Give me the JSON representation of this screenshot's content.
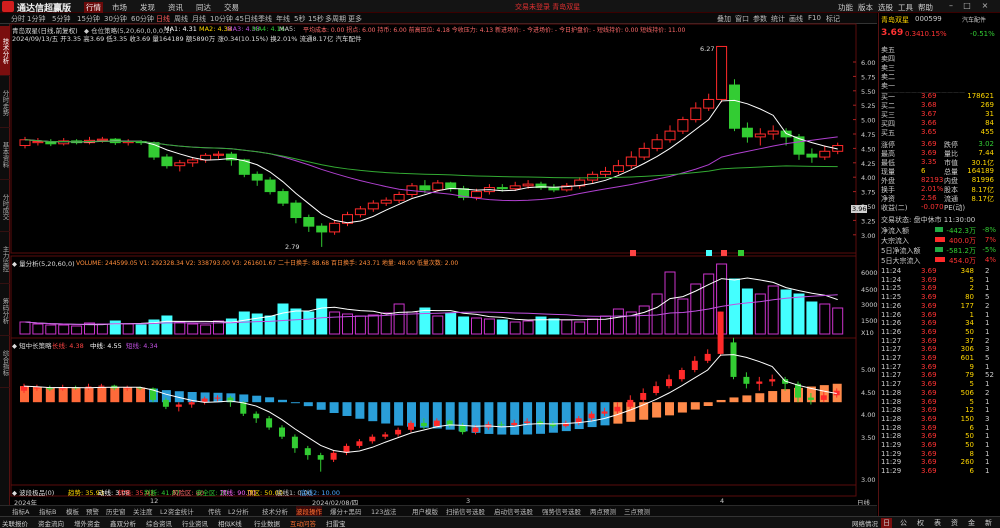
{
  "app": {
    "name": "通达信超赢版",
    "menu": [
      "行情",
      "市场",
      "发现",
      "资讯",
      "同达",
      "交易"
    ],
    "hint": "交易未登录 青岛双星",
    "right_menu": [
      "功能",
      "版本",
      "选股",
      "工具",
      "帮助"
    ]
  },
  "periods": [
    "分时",
    "1分钟",
    "5分钟",
    "15分钟",
    "30分钟",
    "60分钟",
    "日线",
    "周线",
    "月线",
    "10分钟",
    "45日线",
    "季线",
    "年线",
    "5秒",
    "15秒",
    "多周期",
    "更多"
  ],
  "tools": [
    "叠加",
    "窗口",
    "参数",
    "统计",
    "画线",
    "F10",
    "标记"
  ],
  "left_tabs": [
    "技术分析",
    "分时走势",
    "基本资料",
    "分时成交",
    "主力监控",
    "筹码分析",
    "综合指标"
  ],
  "chart_header": {
    "title": "青岛双星(日线,前复权)",
    "line2": "2024/09/13/五 开3.35 高3.69 低3.35 收3.69 量164189 额5890万 涨0.34(10.15%) 换2.01% 流通8.17亿 汽车配件",
    "ma_label": "◆ 仓位策略(5,20,60,0,0,0,1)",
    "ma1": "MA1: 4.31",
    "ma2": "MA2: 4.38",
    "ma3": "MA3: 4.38",
    "ma4": "MA4: 4.16",
    "ma5": "MA5:",
    "extra": "平均成本: 0.00 拐点: 6.00 持币: 6.00 前高压位: 4.18 今收压力: 4.13 新进场价: - 今进场价: - 今日护盘价: - 短线持价: 0.00 短线持价: 11.00"
  },
  "price_axis": [
    "6.00",
    "5.75",
    "5.50",
    "5.25",
    "5.00",
    "4.75",
    "4.50",
    "4.25",
    "4.00",
    "3.75",
    "3.50",
    "3.25",
    "3.00"
  ],
  "price_marks": {
    "high": "6.27",
    "low": "2.79",
    "right": "3.96"
  },
  "vol_header": {
    "label": "◆ 量分析(5,20,60,0)",
    "text": "VOLUME: 244599.05  V1: 292328.34  V2: 338793.00  V3: 261601.67  二十日换手: 88.68  百日换手: 243.71  地量: 48.00  低量次数: 2.00"
  },
  "vol_axis": [
    "60000",
    "45000",
    "30000",
    "15000",
    "X10"
  ],
  "mid_header": {
    "label": "◆ 短中长策略",
    "short": "长线: 4.38",
    "mid": "中线: 4.55",
    "long": "短线: 4.34"
  },
  "mid_axis": [
    "5.00",
    "4.50",
    "4.00",
    "3.50",
    "3.00"
  ],
  "bot_header": {
    "label": "◆ 波段极品(0)",
    "a": "趋势: 35.93",
    "b": "动线: 3.08",
    "c": "转强: 35.93",
    "d": "判断: 41.87",
    "e": "风险区: 80",
    "f": "安全区: 20",
    "g": "顶线: 90.00",
    "h": "顶区: 50.00",
    "i": "底线1: 0.00",
    "j": "底线2: 10.00"
  },
  "time_axis": [
    "2024年",
    "12",
    "2024/02/08/四",
    "3",
    "4",
    "日线"
  ],
  "bottom_tabs": [
    "指标A",
    "指标B",
    "模板",
    "预警",
    "历史窗",
    "关注度",
    "L2资金统计",
    "传统",
    "L2分析",
    "技术分析",
    "波段操作",
    "爆分+黑码",
    "123战法",
    "用户模版",
    "扫描信号选股",
    "启动信号选股",
    "强势信号选股",
    "两点预测",
    "三点预测"
  ],
  "status_bar": [
    "关联报价",
    "资金流向",
    "增外资金",
    "鑫双分析",
    "综合资讯",
    "行业资讯",
    "相似K线",
    "行业数据",
    "互动问答",
    "扫雷宝"
  ],
  "status_right": [
    "网络情况"
  ],
  "quote": {
    "name": "青岛双星",
    "code": "000599",
    "industry": "汽车配件",
    "price": "3.69",
    "change": "0.34",
    "pct": "10.15%",
    "other": "-0.51%",
    "sells": [
      {
        "l": "卖五",
        "p": "",
        "v": ""
      },
      {
        "l": "卖四",
        "p": "",
        "v": ""
      },
      {
        "l": "卖三",
        "p": "",
        "v": ""
      },
      {
        "l": "卖二",
        "p": "",
        "v": ""
      },
      {
        "l": "卖一",
        "p": "",
        "v": ""
      }
    ],
    "buys": [
      {
        "l": "买一",
        "p": "3.69",
        "v": "178621"
      },
      {
        "l": "买二",
        "p": "3.68",
        "v": "269"
      },
      {
        "l": "买三",
        "p": "3.67",
        "v": "31"
      },
      {
        "l": "买四",
        "p": "3.66",
        "v": "84"
      },
      {
        "l": "买五",
        "p": "3.65",
        "v": "455"
      }
    ],
    "stats": [
      [
        "涨停",
        "3.69",
        "跌停",
        "3.02"
      ],
      [
        "最高",
        "3.69",
        "量比",
        "7.44"
      ],
      [
        "最低",
        "3.35",
        "市值",
        "30.1亿"
      ],
      [
        "现量",
        "6",
        "总量",
        "164189"
      ],
      [
        "外盘",
        "82193",
        "内盘",
        "81996"
      ],
      [
        "换手",
        "2.01%",
        "股本",
        "8.17亿"
      ],
      [
        "净资",
        "2.56",
        "流通",
        "8.17亿"
      ],
      [
        "收益(二)",
        "-0.070",
        "PE(动)",
        ""
      ]
    ],
    "state": "交易状态: 盘中休市 11:30:00",
    "flows": [
      {
        "l": "净流入额",
        "v": "-442.3万",
        "p": "-8%"
      },
      {
        "l": "大宗流入",
        "v": "400.0万",
        "p": "7%"
      },
      {
        "l": "5日净流入额",
        "v": "-581.2万",
        "p": "-5%"
      },
      {
        "l": "5日大宗流入",
        "v": "454.0万",
        "p": "4%"
      }
    ],
    "ticks": [
      [
        "11:24",
        "3.69",
        "348",
        "2"
      ],
      [
        "11:24",
        "3.69",
        "5",
        "1"
      ],
      [
        "11:25",
        "3.69",
        "2",
        "1"
      ],
      [
        "11:25",
        "3.69",
        "80",
        "5"
      ],
      [
        "11:26",
        "3.69",
        "177",
        "2"
      ],
      [
        "11:26",
        "3.69",
        "1",
        "1"
      ],
      [
        "11:26",
        "3.69",
        "34",
        "1"
      ],
      [
        "11:26",
        "3.69",
        "50",
        "1"
      ],
      [
        "11:27",
        "3.69",
        "37",
        "2"
      ],
      [
        "11:27",
        "3.69",
        "306",
        "3"
      ],
      [
        "11:27",
        "3.69",
        "601",
        "5"
      ],
      [
        "11:27",
        "3.69",
        "9",
        "1"
      ],
      [
        "11:27",
        "3.69",
        "79",
        "52"
      ],
      [
        "11:27",
        "3.69",
        "5",
        "1"
      ],
      [
        "11:28",
        "3.69",
        "506",
        "2"
      ],
      [
        "11:28",
        "3.69",
        "5",
        "1"
      ],
      [
        "11:28",
        "3.69",
        "12",
        "1"
      ],
      [
        "11:28",
        "3.69",
        "150",
        "3"
      ],
      [
        "11:28",
        "3.69",
        "6",
        "1"
      ],
      [
        "11:28",
        "3.69",
        "50",
        "1"
      ],
      [
        "11:29",
        "3.69",
        "50",
        "1"
      ],
      [
        "11:29",
        "3.69",
        "8",
        "1"
      ],
      [
        "11:29",
        "3.69",
        "260",
        "1"
      ],
      [
        "11:29",
        "3.69",
        "6",
        "1"
      ]
    ],
    "bottom_labels": [
      "日",
      "公",
      "权",
      "表",
      "资",
      "金",
      "新"
    ]
  },
  "colors": {
    "up": "#ff2a2a",
    "down": "#33cc33",
    "cyan": "#44ffff",
    "accent": "#7a0e0e"
  }
}
